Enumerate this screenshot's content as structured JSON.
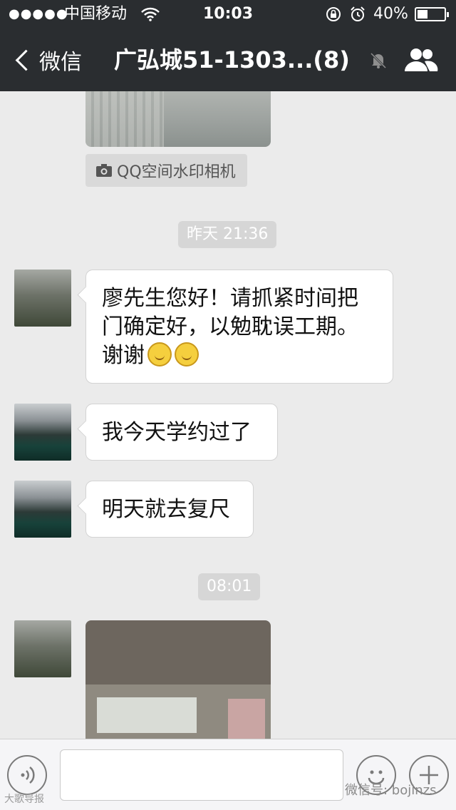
{
  "status_bar": {
    "signal": "●●●●●",
    "carrier": "中国移动",
    "time": "10:03",
    "battery": "40%",
    "battery_level": 0.4
  },
  "nav": {
    "back_label": "微信",
    "title": "广弘城51-1303...(8)"
  },
  "chat": {
    "image_source_tag": "QQ空间水印相机",
    "timestamps": [
      "昨天 21:36",
      "08:01"
    ],
    "messages": [
      {
        "sender_avatar": "tree",
        "text_lines": [
          "廖先生您好！请抓紧时间把",
          "门确定好，以勉耽误工期。",
          "谢谢"
        ],
        "emoji_count": 2
      },
      {
        "sender_avatar": "sea",
        "text": "我今天学约过了"
      },
      {
        "sender_avatar": "sea",
        "text": "明天就去复尺"
      }
    ]
  },
  "input_bar": {
    "text_value": ""
  },
  "watermarks": {
    "left": "大歌导报",
    "right": "微信号: bojinzs"
  },
  "colors": {
    "header_bg": "#2a2d30",
    "chat_bg": "#ebebeb",
    "bubble_bg": "#ffffff",
    "timestamp_bg": "#d6d6d6"
  }
}
